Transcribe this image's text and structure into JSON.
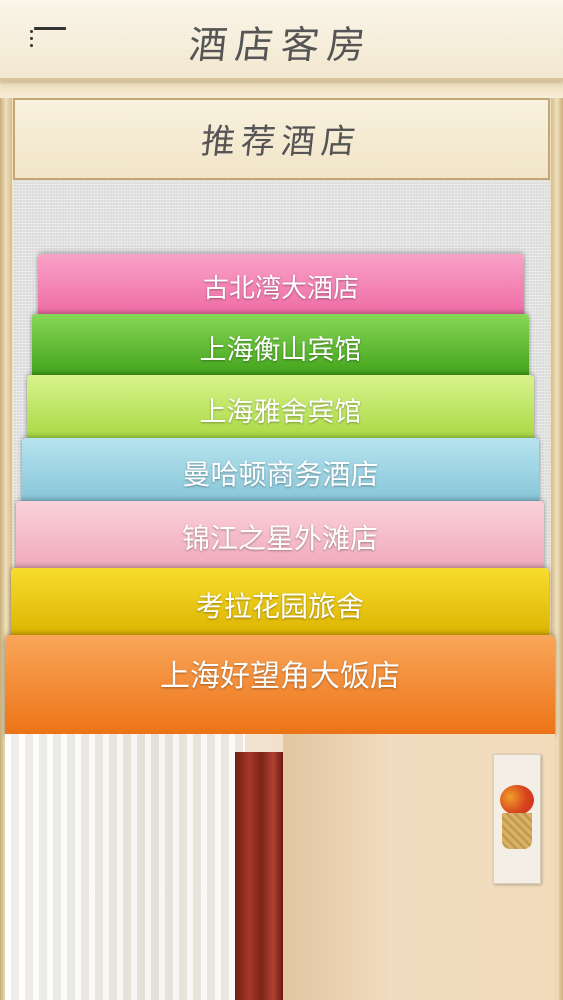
{
  "header": {
    "title": "酒店客房",
    "menu_icon": "hamburger-menu-icon"
  },
  "section": {
    "title": "推荐酒店"
  },
  "hotels": [
    {
      "name": "古北湾大酒店",
      "color": "#ef7fb0"
    },
    {
      "name": "上海衡山宾馆",
      "color": "#4fb121"
    },
    {
      "name": "上海雅舍宾馆",
      "color": "#b7e05a"
    },
    {
      "name": "曼哈顿商务酒店",
      "color": "#95cde0"
    },
    {
      "name": "锦江之星外滩店",
      "color": "#f3b8c7"
    },
    {
      "name": "考拉花园旅舍",
      "color": "#e8c50c"
    },
    {
      "name": "上海好望角大饭店",
      "color": "#ef8224"
    }
  ],
  "colors": {
    "bar_background": "#f7efdd",
    "frame_wood": "#d9c49b",
    "panel_linen": "#e4e4e4"
  }
}
